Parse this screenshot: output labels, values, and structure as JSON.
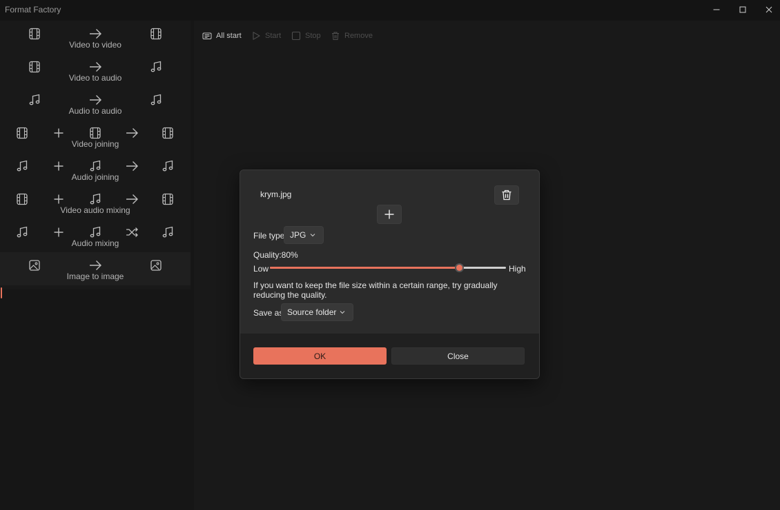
{
  "window": {
    "title": "Format Factory",
    "controls": [
      "minimize",
      "maximize",
      "close"
    ]
  },
  "sidebar": {
    "active_index": 7,
    "items": [
      {
        "label": "Video to video",
        "icons": [
          "film-icon",
          "arrow-right-icon",
          "film-icon"
        ]
      },
      {
        "label": "Video to audio",
        "icons": [
          "film-icon",
          "arrow-right-icon",
          "music-icon"
        ]
      },
      {
        "label": "Audio to audio",
        "icons": [
          "music-icon",
          "arrow-right-icon",
          "music-icon"
        ]
      },
      {
        "label": "Video joining",
        "icons": [
          "film-icon",
          "plus-icon",
          "film-icon",
          "arrow-right-icon",
          "film-icon"
        ]
      },
      {
        "label": "Audio joining",
        "icons": [
          "music-icon",
          "plus-icon",
          "music-icon",
          "arrow-right-icon",
          "music-icon"
        ]
      },
      {
        "label": "Video audio mixing",
        "icons": [
          "film-icon",
          "plus-icon",
          "music-icon",
          "arrow-right-icon",
          "film-icon"
        ]
      },
      {
        "label": "Audio mixing",
        "icons": [
          "music-icon",
          "plus-icon",
          "music-icon",
          "shuffle-icon",
          "music-icon"
        ]
      },
      {
        "label": "Image to image",
        "icons": [
          "image-icon",
          "arrow-right-icon",
          "image-icon"
        ]
      }
    ]
  },
  "toolbar": {
    "all_start": "All start",
    "start": "Start",
    "stop": "Stop",
    "remove": "Remove"
  },
  "dialog": {
    "file_name": "krym.jpg",
    "file_type_label": "File type:",
    "file_type_value": "JPG",
    "quality_label": "Quality:80%",
    "quality_value": 0.8,
    "low_label": "Low",
    "high_label": "High",
    "hint": "If you want to keep the file size within a certain range, try gradually reducing the quality.",
    "save_as_label": "Save as:",
    "save_as_value": "Source folder",
    "ok_label": "OK",
    "close_label": "Close"
  },
  "colors": {
    "accent": "#e8735c",
    "background": "#161616",
    "dialog": "#2b2b2b"
  }
}
